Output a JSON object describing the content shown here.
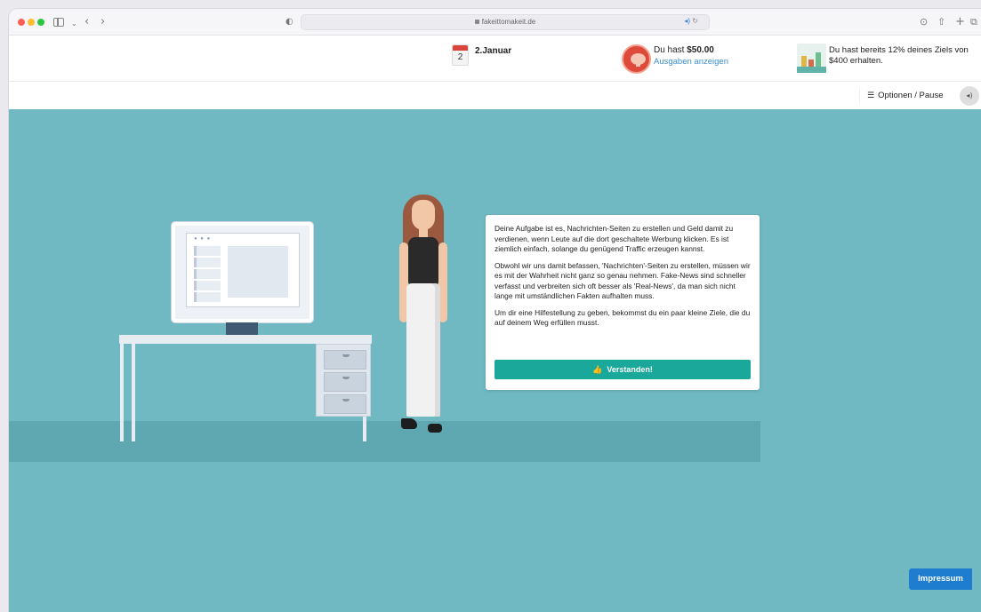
{
  "browser": {
    "url": "fakeittomakeit.de",
    "icons": {
      "back": "‹",
      "forward": "›",
      "shield": "◐",
      "reload": "↻",
      "audio": "◂)",
      "share": "⇧",
      "new_tab": "+",
      "tabs": "⧉",
      "downloads": "⊙"
    }
  },
  "header": {
    "date_day": "2",
    "date_label": "2.Januar",
    "money_prefix": "Du hast ",
    "money_amount": "$50.00",
    "expenses_link": "Ausgaben anzeigen",
    "goal_text": "Du hast bereits 12% deines Ziels von $400 erhalten.",
    "goal_progress_percent": 12,
    "goal_target": "$400"
  },
  "options": {
    "label": "Optionen / Pause",
    "icon": "☰",
    "sound_icon": "◂)"
  },
  "dialog": {
    "paragraphs": [
      "Deine Aufgabe ist es, Nachrichten-Seiten zu erstellen und Geld damit zu verdienen, wenn Leute auf die dort geschaltete Werbung klicken. Es ist ziemlich einfach, solange du genügend Traffic erzeugen kannst.",
      "Obwohl wir uns damit befassen, 'Nachrichten'-Seiten zu erstellen, müssen wir es mit der Wahrheit nicht ganz so genau nehmen. Fake-News sind schneller verfasst und verbreiten sich oft besser als 'Real-News', da man sich nicht lange mit umständlichen Fakten aufhalten muss.",
      "Um dir eine Hilfestellung zu geben, bekommst du ein paar kleine Ziele, die du auf deinem Weg erfüllen musst."
    ],
    "button_label": "Verstanden!",
    "button_icon": "👍"
  },
  "footer": {
    "impressum_label": "Impressum"
  },
  "colors": {
    "scene_bg": "#70b9c3",
    "accent_button": "#1aa89a",
    "impressum": "#1f7dd0",
    "link": "#3b8ed0"
  }
}
